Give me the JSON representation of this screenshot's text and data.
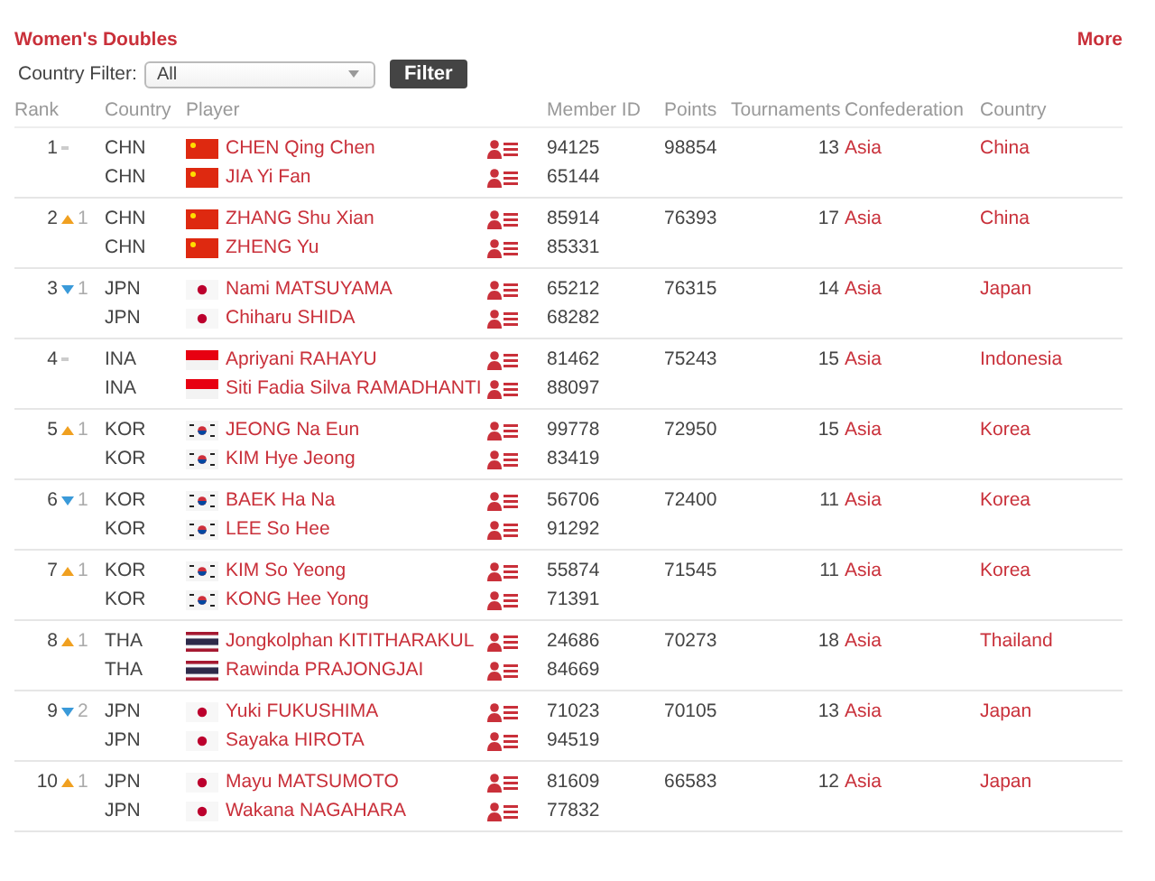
{
  "title": "Women's Doubles",
  "more_link": "More",
  "filter": {
    "label": "Country Filter:",
    "value": "All",
    "button": "Filter"
  },
  "columns": [
    "Rank",
    "Country",
    "Player",
    "Member ID",
    "Points",
    "Tournaments",
    "Confederation",
    "Country"
  ],
  "rows": [
    {
      "rank": "1",
      "movement": {
        "kind": "same"
      },
      "tournaments": "13",
      "points": "98854",
      "confederation": "Asia",
      "country": "China",
      "players": [
        {
          "code": "CHN",
          "flag": {
            "kind": "china"
          },
          "name": "CHEN Qing Chen",
          "member_id": "94125"
        },
        {
          "code": "CHN",
          "flag": {
            "kind": "china"
          },
          "name": "JIA Yi Fan",
          "member_id": "65144"
        }
      ]
    },
    {
      "rank": "2",
      "movement": {
        "kind": "up",
        "change": "1"
      },
      "tournaments": "17",
      "points": "76393",
      "confederation": "Asia",
      "country": "China",
      "players": [
        {
          "code": "CHN",
          "flag": {
            "kind": "china"
          },
          "name": "ZHANG Shu Xian",
          "member_id": "85914"
        },
        {
          "code": "CHN",
          "flag": {
            "kind": "china"
          },
          "name": "ZHENG Yu",
          "member_id": "85331"
        }
      ]
    },
    {
      "rank": "3",
      "movement": {
        "kind": "down",
        "change": "1"
      },
      "tournaments": "14",
      "points": "76315",
      "confederation": "Asia",
      "country": "Japan",
      "players": [
        {
          "code": "JPN",
          "flag": {
            "kind": "japan"
          },
          "name": "Nami MATSUYAMA",
          "member_id": "65212"
        },
        {
          "code": "JPN",
          "flag": {
            "kind": "japan"
          },
          "name": "Chiharu SHIDA",
          "member_id": "68282"
        }
      ]
    },
    {
      "rank": "4",
      "movement": {
        "kind": "same"
      },
      "tournaments": "15",
      "points": "75243",
      "confederation": "Asia",
      "country": "Indonesia",
      "players": [
        {
          "code": "INA",
          "flag": {
            "kind": "indonesia"
          },
          "name": "Apriyani RAHAYU",
          "member_id": "81462"
        },
        {
          "code": "INA",
          "flag": {
            "kind": "indonesia"
          },
          "name": "Siti Fadia Silva RAMADHANTI",
          "member_id": "88097"
        }
      ]
    },
    {
      "rank": "5",
      "movement": {
        "kind": "up",
        "change": "1"
      },
      "tournaments": "15",
      "points": "72950",
      "confederation": "Asia",
      "country": "Korea",
      "players": [
        {
          "code": "KOR",
          "flag": {
            "kind": "korea"
          },
          "name": "JEONG Na Eun",
          "member_id": "99778"
        },
        {
          "code": "KOR",
          "flag": {
            "kind": "korea"
          },
          "name": "KIM Hye Jeong",
          "member_id": "83419"
        }
      ]
    },
    {
      "rank": "6",
      "movement": {
        "kind": "down",
        "change": "1"
      },
      "tournaments": "11",
      "points": "72400",
      "confederation": "Asia",
      "country": "Korea",
      "players": [
        {
          "code": "KOR",
          "flag": {
            "kind": "korea"
          },
          "name": "BAEK Ha Na",
          "member_id": "56706"
        },
        {
          "code": "KOR",
          "flag": {
            "kind": "korea"
          },
          "name": "LEE So Hee",
          "member_id": "91292"
        }
      ]
    },
    {
      "rank": "7",
      "movement": {
        "kind": "up",
        "change": "1"
      },
      "tournaments": "11",
      "points": "71545",
      "confederation": "Asia",
      "country": "Korea",
      "players": [
        {
          "code": "KOR",
          "flag": {
            "kind": "korea"
          },
          "name": "KIM So Yeong",
          "member_id": "55874"
        },
        {
          "code": "KOR",
          "flag": {
            "kind": "korea"
          },
          "name": "KONG Hee Yong",
          "member_id": "71391"
        }
      ]
    },
    {
      "rank": "8",
      "movement": {
        "kind": "up",
        "change": "1"
      },
      "tournaments": "18",
      "points": "70273",
      "confederation": "Asia",
      "country": "Thailand",
      "players": [
        {
          "code": "THA",
          "flag": {
            "kind": "thailand"
          },
          "name": "Jongkolphan KITITHARAKUL",
          "member_id": "24686"
        },
        {
          "code": "THA",
          "flag": {
            "kind": "thailand"
          },
          "name": "Rawinda PRAJONGJAI",
          "member_id": "84669"
        }
      ]
    },
    {
      "rank": "9",
      "movement": {
        "kind": "down",
        "change": "2"
      },
      "tournaments": "13",
      "points": "70105",
      "confederation": "Asia",
      "country": "Japan",
      "players": [
        {
          "code": "JPN",
          "flag": {
            "kind": "japan"
          },
          "name": "Yuki FUKUSHIMA",
          "member_id": "71023"
        },
        {
          "code": "JPN",
          "flag": {
            "kind": "japan"
          },
          "name": "Sayaka HIROTA",
          "member_id": "94519"
        }
      ]
    },
    {
      "rank": "10",
      "movement": {
        "kind": "up",
        "change": "1"
      },
      "tournaments": "12",
      "points": "66583",
      "confederation": "Asia",
      "country": "Japan",
      "players": [
        {
          "code": "JPN",
          "flag": {
            "kind": "japan"
          },
          "name": "Mayu MATSUMOTO",
          "member_id": "81609"
        },
        {
          "code": "JPN",
          "flag": {
            "kind": "japan"
          },
          "name": "Wakana NAGAHARA",
          "member_id": "77832"
        }
      ]
    }
  ]
}
